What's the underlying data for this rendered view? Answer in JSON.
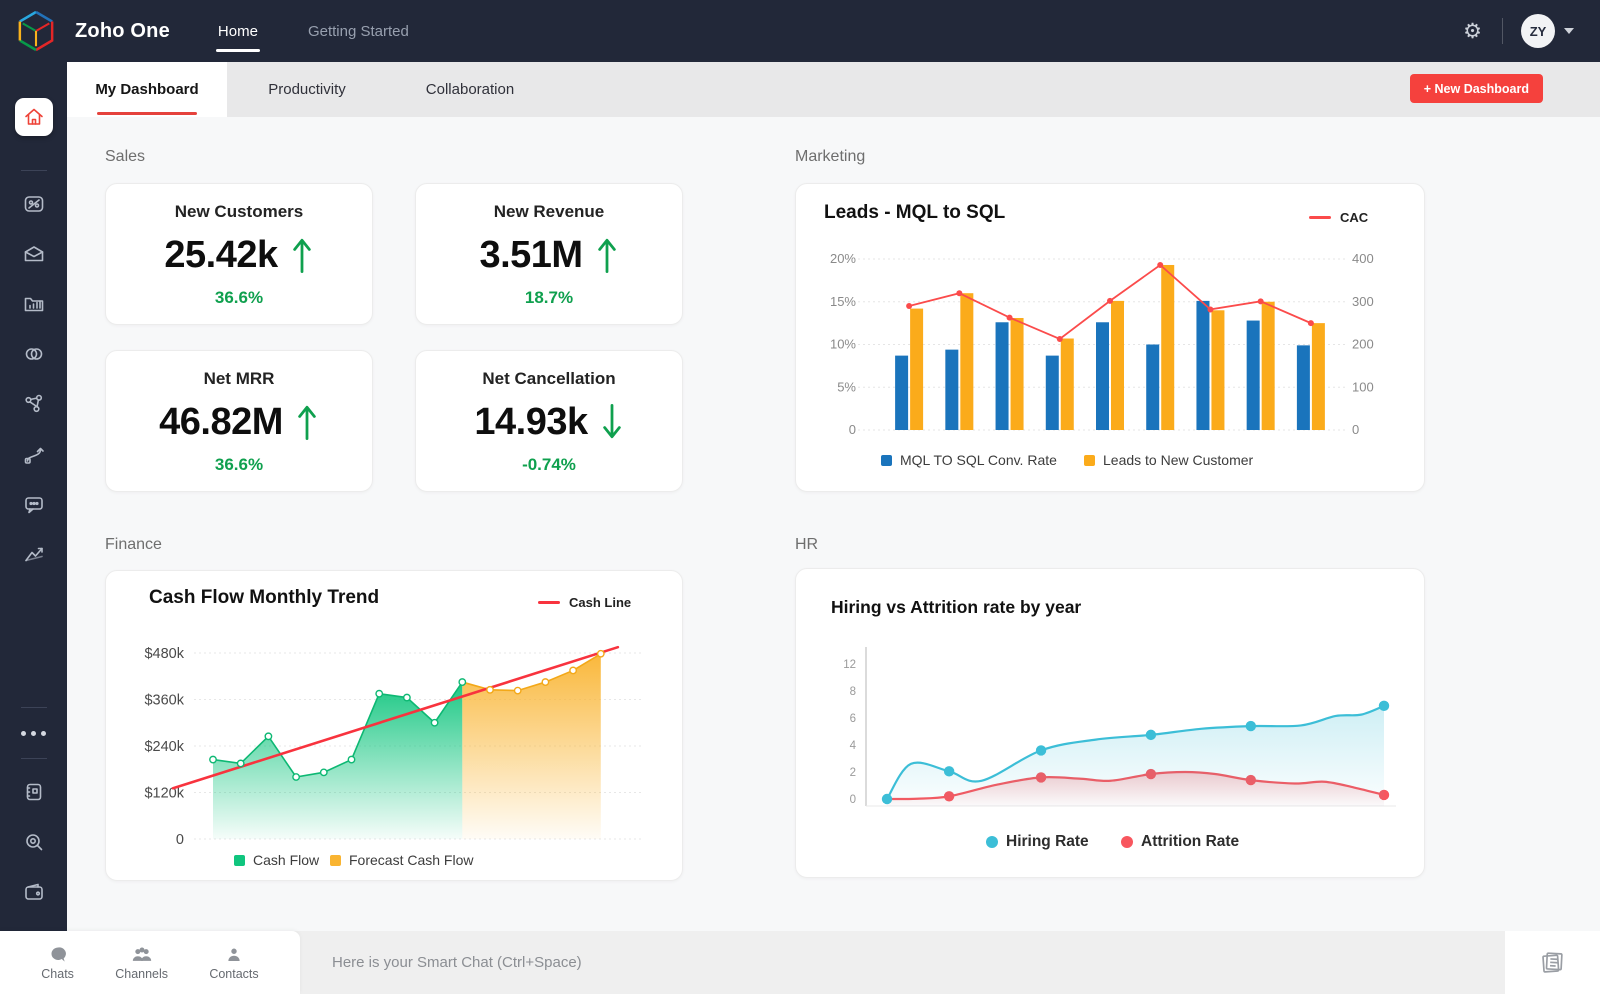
{
  "colors": {
    "accent_red": "#f5413d",
    "navy": "#222839",
    "kpi_green": "#0fa04e",
    "bar_blue": "#1a74bc",
    "bar_orange": "#fbab1b",
    "line_red": "#fb4b4b",
    "area_green": "#10c57e",
    "area_orange": "#f9b431",
    "hr_blue": "#3cbed7",
    "hr_red": "#f8565e"
  },
  "topbar": {
    "brand": "Zoho One",
    "nav": [
      {
        "label": "Home"
      },
      {
        "label": "Getting Started"
      }
    ],
    "avatar_initials": "ZY"
  },
  "tabs": {
    "items": [
      {
        "label": "My Dashboard"
      },
      {
        "label": "Productivity"
      },
      {
        "label": "Collaboration"
      }
    ],
    "new_dashboard": "+ New Dashboard"
  },
  "sidebar": {
    "icons": [
      "home",
      "crm",
      "mail",
      "projects",
      "rings",
      "network",
      "workflow",
      "chat",
      "analytics",
      "more",
      "notebook",
      "search",
      "wallet"
    ]
  },
  "sections": {
    "sales": {
      "label": "Sales",
      "cards": [
        {
          "title": "New Customers",
          "value": "25.42k",
          "direction": "up",
          "percent": "36.6%"
        },
        {
          "title": "New Revenue",
          "value": "3.51M",
          "direction": "up",
          "percent": "18.7%"
        },
        {
          "title": "Net MRR",
          "value": "46.82M",
          "direction": "up",
          "percent": "36.6%"
        },
        {
          "title": "Net Cancellation",
          "value": "14.93k",
          "direction": "down",
          "percent": "-0.74%"
        }
      ]
    },
    "marketing": {
      "label": "Marketing"
    },
    "finance": {
      "label": "Finance"
    },
    "hr": {
      "label": "HR"
    }
  },
  "bottombar": {
    "items": [
      {
        "label": "Chats",
        "icon": "chat-bubble"
      },
      {
        "label": "Channels",
        "icon": "people-group"
      },
      {
        "label": "Contacts",
        "icon": "person"
      }
    ],
    "smart_chat_placeholder": "Here is your Smart Chat (Ctrl+Space)",
    "corner_icon": "documents"
  },
  "chart_data": [
    {
      "id": "marketing",
      "type": "bar+line",
      "title": "Leads - MQL to SQL",
      "left_axis": {
        "ticks": [
          "20%",
          "15%",
          "10%",
          "5%",
          "0"
        ],
        "max": 20
      },
      "right_axis": {
        "ticks": [
          "400",
          "300",
          "200",
          "100",
          "0"
        ],
        "max": 400
      },
      "series": [
        {
          "name": "MQL TO SQL Conv. Rate",
          "color": "#1a74bc",
          "values": [
            8.7,
            9.4,
            12.6,
            8.7,
            12.6,
            10,
            15.1,
            12.8,
            9.9
          ]
        },
        {
          "name": "Leads to New Customer",
          "color": "#fbab1b",
          "values": [
            14.2,
            16,
            13.1,
            10.7,
            15.1,
            19.3,
            14,
            15,
            12.5
          ]
        }
      ],
      "line_series": {
        "name": "CAC",
        "color": "#fb4b4b",
        "axis": "right",
        "values": [
          290,
          320,
          263,
          213,
          302,
          386,
          282,
          301,
          250
        ]
      },
      "grid": true,
      "legend_position": "bottom"
    },
    {
      "id": "finance",
      "type": "area+line",
      "title": "Cash Flow Monthly Trend",
      "y_axis": {
        "ticks": [
          "$480k",
          "$360k",
          "$240k",
          "$120k",
          "0"
        ],
        "max": 480
      },
      "series": [
        {
          "name": "Cash Flow",
          "color": "#10c57e",
          "line_color": "#0db873",
          "values": [
            205,
            195,
            265,
            160,
            172,
            205,
            375,
            365,
            300,
            405
          ]
        },
        {
          "name": "Forecast Cash Flow",
          "color": "#f9b431",
          "line_color": "#f3a818",
          "values": [
            385,
            383,
            405,
            435,
            478
          ]
        }
      ],
      "trend_line": {
        "name": "Cash Line",
        "color": "#f8333e",
        "start_value": 131,
        "end_value": 495
      },
      "grid": true,
      "legend_position": "bottom"
    },
    {
      "id": "hr",
      "type": "line-smooth",
      "title": "Hiring vs Attrition rate by year",
      "y_axis": {
        "ticks": [
          "12",
          "8",
          "6",
          "4",
          "2",
          "0"
        ],
        "values": [
          12,
          8,
          6,
          4,
          2,
          0
        ]
      },
      "series": [
        {
          "name": "Hiring Rate",
          "color": "#3cbed7",
          "dots": [
            [
              0,
              0
            ],
            [
              0.125,
              2.05
            ],
            [
              0.31,
              3.6
            ],
            [
              0.531,
              4.75
            ],
            [
              0.732,
              5.4
            ],
            [
              1,
              6.9
            ]
          ],
          "curve": [
            [
              0,
              0
            ],
            [
              0.048,
              2.6
            ],
            [
              0.125,
              2.05
            ],
            [
              0.19,
              1.35
            ],
            [
              0.31,
              3.6
            ],
            [
              0.42,
              4.4
            ],
            [
              0.531,
              4.75
            ],
            [
              0.632,
              5.2
            ],
            [
              0.732,
              5.4
            ],
            [
              0.833,
              5.45
            ],
            [
              0.903,
              6.15
            ],
            [
              0.954,
              6.25
            ],
            [
              1,
              6.9
            ]
          ]
        },
        {
          "name": "Attrition Rate",
          "color": "#f8565e",
          "dots": [
            [
              0.125,
              0.2
            ],
            [
              0.31,
              1.6
            ],
            [
              0.531,
              1.85
            ],
            [
              0.732,
              1.4
            ],
            [
              1,
              0.3
            ]
          ],
          "curve": [
            [
              0,
              0
            ],
            [
              0.06,
              0.02
            ],
            [
              0.125,
              0.2
            ],
            [
              0.22,
              1.05
            ],
            [
              0.31,
              1.6
            ],
            [
              0.39,
              1.5
            ],
            [
              0.45,
              1.35
            ],
            [
              0.531,
              1.85
            ],
            [
              0.6,
              2.0
            ],
            [
              0.66,
              1.85
            ],
            [
              0.732,
              1.4
            ],
            [
              0.82,
              1.15
            ],
            [
              0.88,
              1.28
            ],
            [
              0.94,
              0.85
            ],
            [
              1,
              0.3
            ]
          ]
        }
      ],
      "legend_position": "bottom"
    }
  ]
}
